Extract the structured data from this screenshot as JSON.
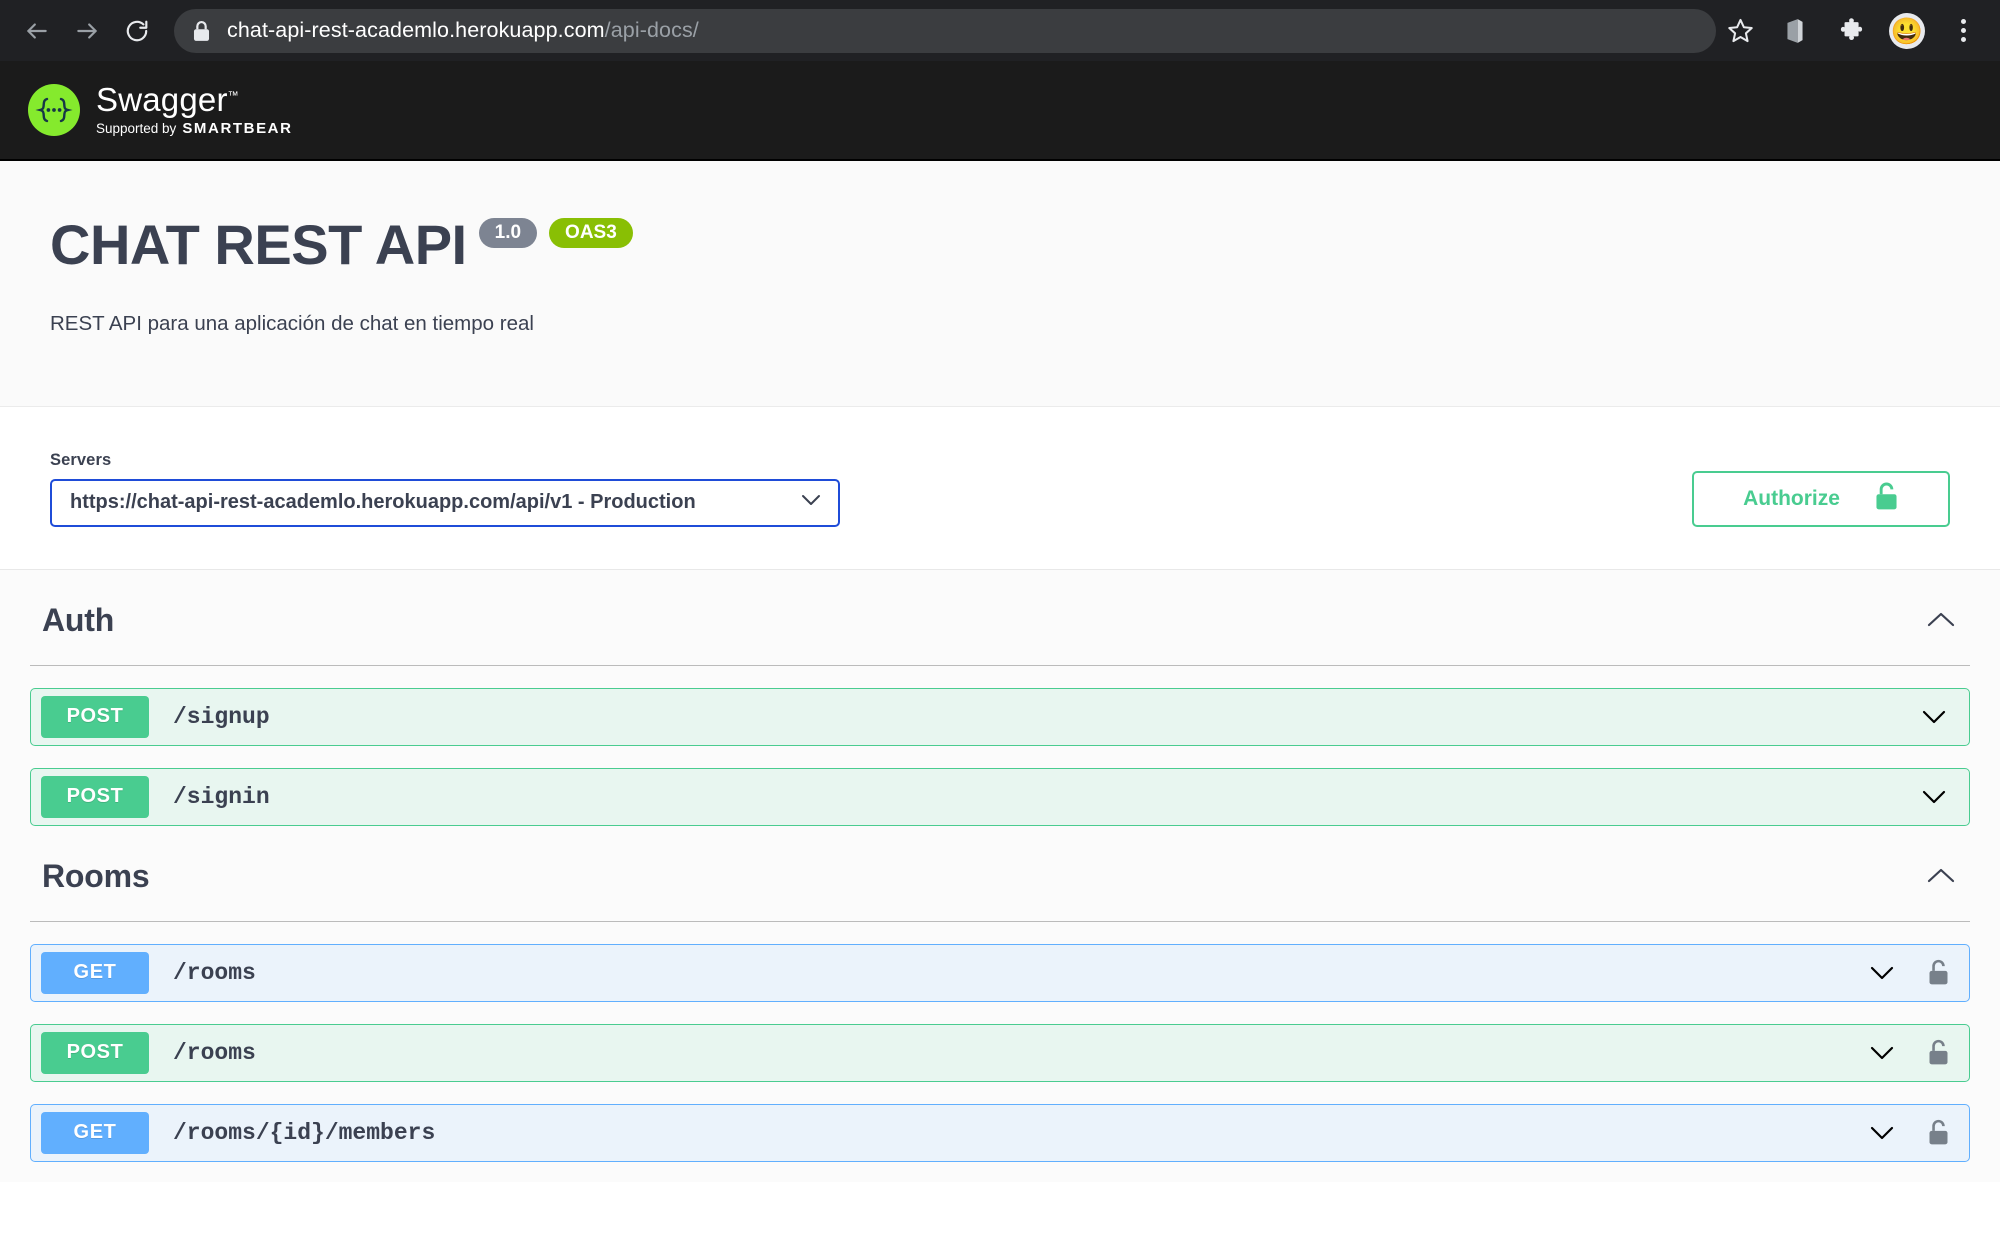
{
  "browser": {
    "back_icon": "back-arrow-icon",
    "forward_icon": "forward-arrow-icon",
    "reload_icon": "reload-icon",
    "site_lock_icon": "padlock-icon",
    "url_domain": "chat-api-rest-academlo.herokuapp.com",
    "url_path": "/api-docs/",
    "bookmark_icon": "star-icon",
    "office_icon": "office-icon",
    "extensions_icon": "puzzle-piece-icon",
    "profile_icon": "emoji-avatar-icon",
    "profile_emoji": "😃",
    "menu_icon": "three-dot-menu-icon"
  },
  "topbar": {
    "logo_icon": "swagger-braces-logo-icon",
    "logo_glyph": "{...}",
    "brand": "Swagger",
    "trademark": "™",
    "supported_by": "Supported by",
    "sponsor": "SMARTBEAR"
  },
  "info": {
    "title": "CHAT REST API",
    "version_badge": "1.0",
    "spec_badge": "OAS3",
    "description": "REST API para una aplicación de chat en tiempo real"
  },
  "servers": {
    "label": "Servers",
    "selected": "https://chat-api-rest-academlo.herokuapp.com/api/v1 - Production",
    "chevron_icon": "chevron-down-icon",
    "authorize_label": "Authorize",
    "authorize_icon": "unlock-icon"
  },
  "colors": {
    "get": "#61affe",
    "post": "#49cc90",
    "oas_badge": "#89bf04",
    "version_badge": "#7d8492",
    "accent_text": "#3b4151",
    "server_border": "#1f4cd8",
    "swagger_green": "#85ea2d"
  },
  "sections": [
    {
      "name": "Auth",
      "collapse_icon": "chevron-up-icon",
      "operations": [
        {
          "method": "POST",
          "path": "/signup",
          "secured": false,
          "chevron_icon": "chevron-down-icon"
        },
        {
          "method": "POST",
          "path": "/signin",
          "secured": false,
          "chevron_icon": "chevron-down-icon"
        }
      ]
    },
    {
      "name": "Rooms",
      "collapse_icon": "chevron-up-icon",
      "operations": [
        {
          "method": "GET",
          "path": "/rooms",
          "secured": true,
          "chevron_icon": "chevron-down-icon",
          "lock_icon": "unlock-icon"
        },
        {
          "method": "POST",
          "path": "/rooms",
          "secured": true,
          "chevron_icon": "chevron-down-icon",
          "lock_icon": "unlock-icon"
        },
        {
          "method": "GET",
          "path": "/rooms/{id}/members",
          "secured": true,
          "chevron_icon": "chevron-down-icon",
          "lock_icon": "unlock-icon"
        }
      ]
    }
  ]
}
